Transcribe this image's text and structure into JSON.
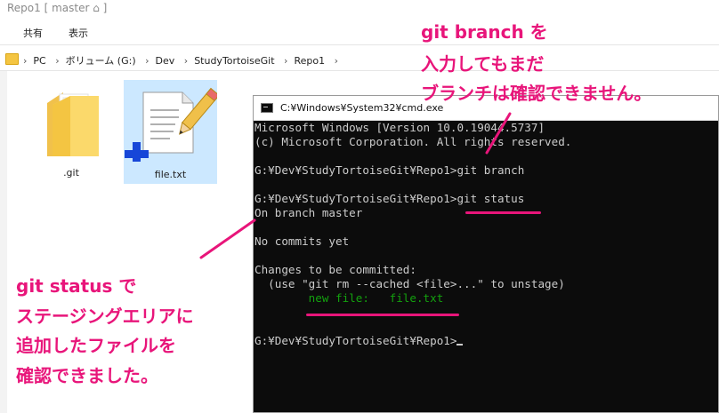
{
  "explorer": {
    "window_title": "Repo1 [ master ⌂ ]",
    "ribbon_tabs": [
      "共有",
      "表示"
    ],
    "breadcrumb": [
      "PC",
      "ボリューム (G:)",
      "Dev",
      "StudyTortoiseGit",
      "Repo1"
    ],
    "breadcrumb_sep": "›",
    "files": [
      {
        "name": ".git",
        "icon": "folder-icon"
      },
      {
        "name": "file.txt",
        "icon": "text-file-added-icon",
        "selected": true
      }
    ]
  },
  "cmd": {
    "title": "C:¥Windows¥System32¥cmd.exe",
    "lines": [
      "Microsoft Windows [Version 10.0.19044.5737]",
      "(c) Microsoft Corporation. All rights reserved.",
      "",
      "G:¥Dev¥StudyTortoiseGit¥Repo1>git branch",
      "",
      "G:¥Dev¥StudyTortoiseGit¥Repo1>git status",
      "On branch master",
      "",
      "No commits yet",
      "",
      "Changes to be committed:",
      "  (use \"git rm --cached <file>...\" to unstage)",
      "        new file:   file.txt",
      "",
      "G:¥Dev¥StudyTortoiseGit¥Repo1>"
    ],
    "green_line_index": 12
  },
  "annotations": {
    "top": [
      "git branch を",
      "入力してもまだ",
      "ブランチは確認できません。"
    ],
    "left": [
      "git status で",
      "ステージングエリアに",
      "追加したファイルを",
      "確認できました。"
    ]
  },
  "colors": {
    "accent": "#e8157a",
    "console_bg": "#0c0c0c",
    "console_fg": "#cccccc",
    "console_green": "#13a10e",
    "selection": "#cce8ff"
  }
}
